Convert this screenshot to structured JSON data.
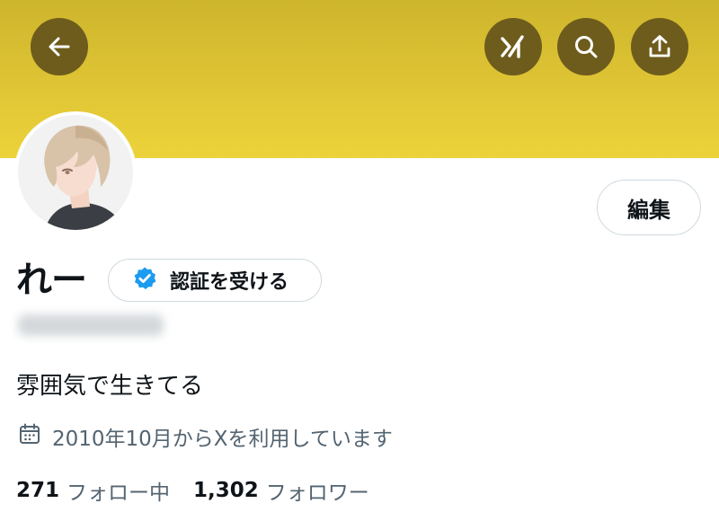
{
  "profile": {
    "display_name": "れー",
    "verify_label": "認証を受ける",
    "bio": "雰囲気で生きてる",
    "joined": "2010年10月からXを利用しています",
    "following_count": "271",
    "following_label": "フォロー中",
    "followers_count": "1,302",
    "followers_label": "フォロワー"
  },
  "actions": {
    "edit_label": "編集"
  },
  "colors": {
    "banner": "#dcc233",
    "header_button": "#6e5c1d",
    "verified_badge": "#1d9bf0",
    "muted_text": "#536471",
    "border": "#cfd9de"
  },
  "icons": {
    "back": "arrow-left-icon",
    "grok": "grok-icon",
    "search": "search-icon",
    "share": "share-icon",
    "verified": "verified-badge-icon",
    "calendar": "calendar-icon"
  }
}
